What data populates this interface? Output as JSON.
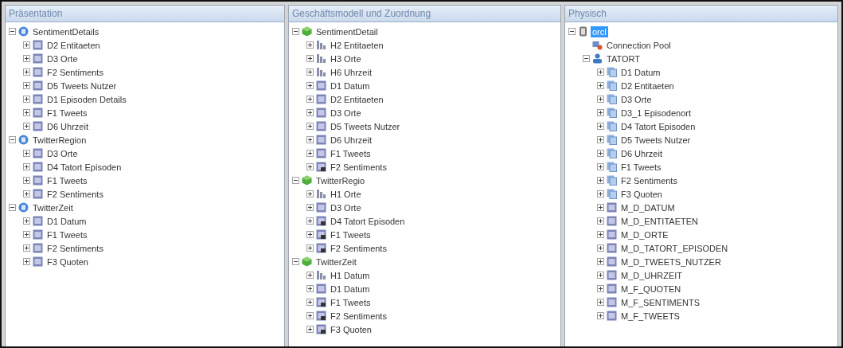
{
  "panels": [
    {
      "title": "Präsentation",
      "tree": [
        {
          "label": "SentimentDetails",
          "kind": "catalog",
          "expanded": true,
          "selected": false,
          "children": [
            {
              "label": "D2 Entitaeten",
              "kind": "table",
              "expanded": false,
              "selected": false
            },
            {
              "label": "D3 Orte",
              "kind": "table",
              "expanded": false,
              "selected": false
            },
            {
              "label": "F2 Sentiments",
              "kind": "table",
              "expanded": false,
              "selected": false
            },
            {
              "label": "D5 Tweets Nutzer",
              "kind": "table",
              "expanded": false,
              "selected": false
            },
            {
              "label": "D1  Episoden Details",
              "kind": "table",
              "expanded": false,
              "selected": false
            },
            {
              "label": "F1 Tweets",
              "kind": "table",
              "expanded": false,
              "selected": false
            },
            {
              "label": "D6 Uhrzeit",
              "kind": "table",
              "expanded": false,
              "selected": false
            }
          ]
        },
        {
          "label": "TwitterRegion",
          "kind": "catalog",
          "expanded": true,
          "selected": false,
          "children": [
            {
              "label": "D3 Orte",
              "kind": "table",
              "expanded": false,
              "selected": false
            },
            {
              "label": "D4 Tatort Episoden",
              "kind": "table",
              "expanded": false,
              "selected": false
            },
            {
              "label": "F1 Tweets",
              "kind": "table",
              "expanded": false,
              "selected": false
            },
            {
              "label": "F2 Sentiments",
              "kind": "table",
              "expanded": false,
              "selected": false
            }
          ]
        },
        {
          "label": "TwitterZeit",
          "kind": "catalog",
          "expanded": true,
          "selected": false,
          "children": [
            {
              "label": "D1  Datum",
              "kind": "table",
              "expanded": false,
              "selected": false
            },
            {
              "label": "F1 Tweets",
              "kind": "table",
              "expanded": false,
              "selected": false
            },
            {
              "label": "F2 Sentiments",
              "kind": "table",
              "expanded": false,
              "selected": false
            },
            {
              "label": "F3 Quoten",
              "kind": "table",
              "expanded": false,
              "selected": false
            }
          ]
        }
      ]
    },
    {
      "title": "Geschäftsmodell und Zuordnung",
      "tree": [
        {
          "label": "SentimentDetail",
          "kind": "model",
          "expanded": true,
          "selected": false,
          "children": [
            {
              "label": "H2 Entitaeten",
              "kind": "hierarchy",
              "expanded": false,
              "selected": false
            },
            {
              "label": "H3 Orte",
              "kind": "hierarchy",
              "expanded": false,
              "selected": false
            },
            {
              "label": "H6 Uhrzeit",
              "kind": "hierarchy",
              "expanded": false,
              "selected": false
            },
            {
              "label": "D1  Datum",
              "kind": "table",
              "expanded": false,
              "selected": false
            },
            {
              "label": "D2 Entitaeten",
              "kind": "table",
              "expanded": false,
              "selected": false
            },
            {
              "label": "D3 Orte",
              "kind": "table",
              "expanded": false,
              "selected": false
            },
            {
              "label": "D5 Tweets Nutzer",
              "kind": "table",
              "expanded": false,
              "selected": false
            },
            {
              "label": "D6 Uhrzeit",
              "kind": "table",
              "expanded": false,
              "selected": false
            },
            {
              "label": "F1 Tweets",
              "kind": "table",
              "expanded": false,
              "selected": false
            },
            {
              "label": "F2 Sentiments",
              "kind": "fact",
              "expanded": false,
              "selected": false
            }
          ]
        },
        {
          "label": "TwitterRegio",
          "kind": "model",
          "expanded": true,
          "selected": false,
          "children": [
            {
              "label": "H1 Orte",
              "kind": "hierarchy",
              "expanded": false,
              "selected": false
            },
            {
              "label": "D3 Orte",
              "kind": "table",
              "expanded": false,
              "selected": false
            },
            {
              "label": "D4 Tatort Episoden",
              "kind": "fact",
              "expanded": false,
              "selected": false
            },
            {
              "label": "F1 Tweets",
              "kind": "fact",
              "expanded": false,
              "selected": false
            },
            {
              "label": "F2 Sentiments",
              "kind": "fact",
              "expanded": false,
              "selected": false
            }
          ]
        },
        {
          "label": "TwitterZeit",
          "kind": "model",
          "expanded": true,
          "selected": false,
          "children": [
            {
              "label": "H1 Datum",
              "kind": "hierarchy",
              "expanded": false,
              "selected": false
            },
            {
              "label": "D1  Datum",
              "kind": "table",
              "expanded": false,
              "selected": false
            },
            {
              "label": "F1 Tweets",
              "kind": "fact",
              "expanded": false,
              "selected": false
            },
            {
              "label": "F2 Sentiments",
              "kind": "fact",
              "expanded": false,
              "selected": false
            },
            {
              "label": "F3 Quoten",
              "kind": "fact",
              "expanded": false,
              "selected": false
            }
          ]
        }
      ]
    },
    {
      "title": "Physisch",
      "tree": [
        {
          "label": "orcl",
          "kind": "database",
          "expanded": true,
          "selected": true,
          "children": [
            {
              "label": "Connection Pool",
              "kind": "connection",
              "selected": false
            },
            {
              "label": "TATORT",
              "kind": "schema",
              "expanded": true,
              "selected": false,
              "children": [
                {
                  "label": "D1  Datum",
                  "kind": "alias",
                  "expanded": false,
                  "selected": false
                },
                {
                  "label": "D2 Entitaeten",
                  "kind": "alias",
                  "expanded": false,
                  "selected": false
                },
                {
                  "label": "D3 Orte",
                  "kind": "alias",
                  "expanded": false,
                  "selected": false
                },
                {
                  "label": "D3_1 Episodenort",
                  "kind": "alias",
                  "expanded": false,
                  "selected": false
                },
                {
                  "label": "D4 Tatort Episoden",
                  "kind": "alias",
                  "expanded": false,
                  "selected": false
                },
                {
                  "label": "D5 Tweets Nutzer",
                  "kind": "alias",
                  "expanded": false,
                  "selected": false
                },
                {
                  "label": "D6 Uhrzeit",
                  "kind": "alias",
                  "expanded": false,
                  "selected": false
                },
                {
                  "label": "F1 Tweets",
                  "kind": "alias",
                  "expanded": false,
                  "selected": false
                },
                {
                  "label": "F2 Sentiments",
                  "kind": "alias",
                  "expanded": false,
                  "selected": false
                },
                {
                  "label": "F3 Quoten",
                  "kind": "alias",
                  "expanded": false,
                  "selected": false
                },
                {
                  "label": "M_D_DATUM",
                  "kind": "table",
                  "expanded": false,
                  "selected": false
                },
                {
                  "label": "M_D_ENTITAETEN",
                  "kind": "table",
                  "expanded": false,
                  "selected": false
                },
                {
                  "label": "M_D_ORTE",
                  "kind": "table",
                  "expanded": false,
                  "selected": false
                },
                {
                  "label": "M_D_TATORT_EPISODEN",
                  "kind": "table",
                  "expanded": false,
                  "selected": false
                },
                {
                  "label": "M_D_TWEETS_NUTZER",
                  "kind": "table",
                  "expanded": false,
                  "selected": false
                },
                {
                  "label": "M_D_UHRZEIT",
                  "kind": "table",
                  "expanded": false,
                  "selected": false
                },
                {
                  "label": "M_F_QUOTEN",
                  "kind": "table",
                  "expanded": false,
                  "selected": false
                },
                {
                  "label": "M_F_SENTIMENTS",
                  "kind": "table",
                  "expanded": false,
                  "selected": false
                },
                {
                  "label": "M_F_TWEETS",
                  "kind": "table",
                  "expanded": false,
                  "selected": false
                }
              ]
            }
          ]
        }
      ]
    }
  ]
}
